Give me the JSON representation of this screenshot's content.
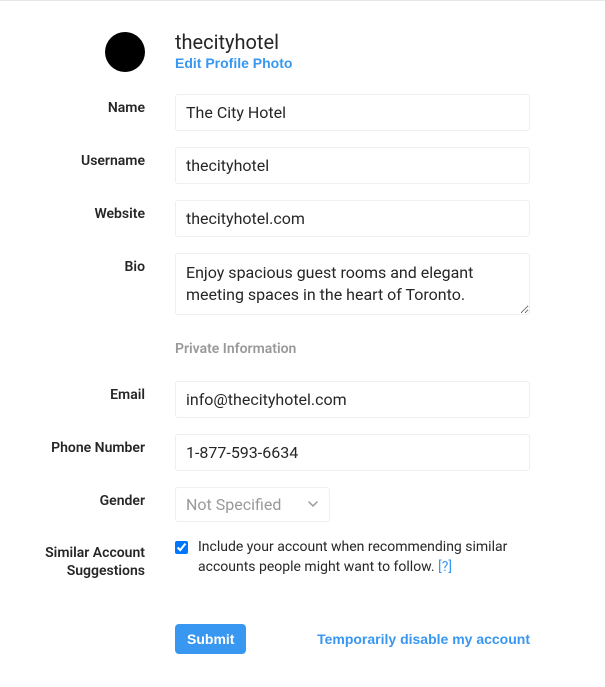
{
  "profile": {
    "username_display": "thecityhotel",
    "edit_photo_label": "Edit Profile Photo"
  },
  "labels": {
    "name": "Name",
    "username": "Username",
    "website": "Website",
    "bio": "Bio",
    "private_info": "Private Information",
    "email": "Email",
    "phone": "Phone Number",
    "gender": "Gender",
    "similar1": "Similar Account",
    "similar2": "Suggestions"
  },
  "fields": {
    "name": "The City Hotel",
    "username": "thecityhotel",
    "website": "thecityhotel.com",
    "bio": "Enjoy spacious guest rooms and elegant meeting spaces in the heart of Toronto.",
    "email": "info@thecityhotel.com",
    "phone": "1-877-593-6634",
    "gender": "Not Specified"
  },
  "similar": {
    "text": "Include your account when recommending similar accounts people might want to follow.",
    "help": "[?]"
  },
  "actions": {
    "submit": "Submit",
    "disable": "Temporarily disable my account"
  }
}
